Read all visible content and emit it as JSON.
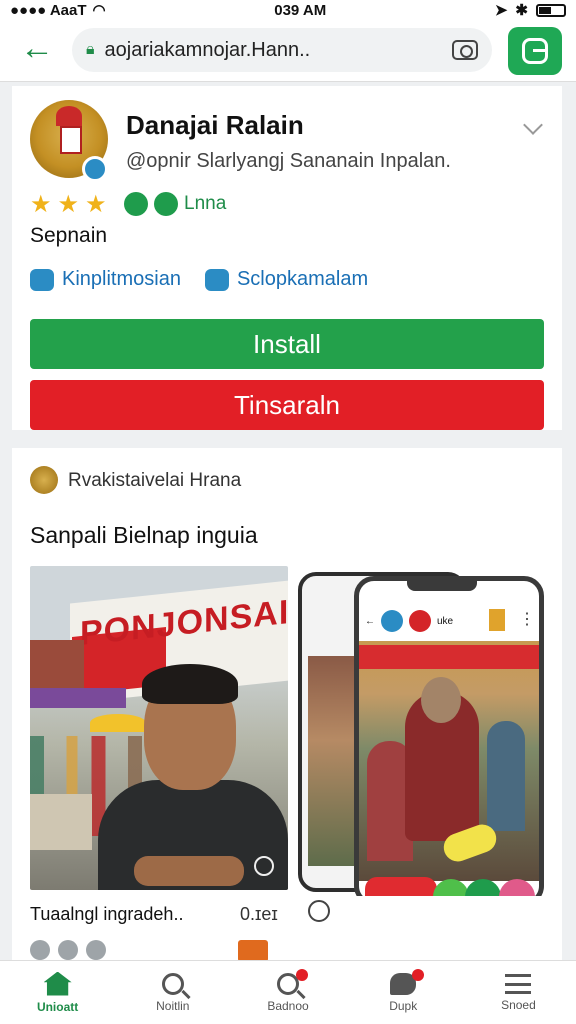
{
  "status_bar": {
    "carrier": "●●●● AaaT",
    "time": "039 AM"
  },
  "browser": {
    "url": "aojariakamnojar.Hann.."
  },
  "app": {
    "title": "Danajai Ralain",
    "subtitle": "@opnir Slarlyangj Sananain Inpalan.",
    "stars": 3,
    "badge_text": "Lnna",
    "category": "Sepnain",
    "links": [
      {
        "label": "Kinplitmosian",
        "icon": "person-icon"
      },
      {
        "label": "Sclopkamalam",
        "icon": "share-icon"
      }
    ],
    "install_label": "Install",
    "secondary_label": "Tinsaraln"
  },
  "media": {
    "source_name": "Rvakistaivelai Hrana",
    "section_title": "Sanpali Bielnap inguia",
    "photo_banner_text": "PONJONSAI",
    "phone_header_text": "uke",
    "caption": "Tuaalngl ingradeh..",
    "caption_meta": "0.ɪeɪ"
  },
  "bottom_nav": [
    {
      "label": "Unioatt",
      "icon": "home-icon",
      "active": true,
      "badge": false
    },
    {
      "label": "Noitlin",
      "icon": "search-icon",
      "active": false,
      "badge": false
    },
    {
      "label": "Badnoo",
      "icon": "search-icon",
      "active": false,
      "badge": true
    },
    {
      "label": "Dupk",
      "icon": "chat-icon",
      "active": false,
      "badge": true
    },
    {
      "label": "Snoed",
      "icon": "menu-icon",
      "active": false,
      "badge": false
    }
  ],
  "colors": {
    "brand_green": "#1f8c49",
    "install_green": "#23a14b",
    "alert_red": "#e21f26",
    "link_blue": "#1a6fb5",
    "star_gold": "#f0b21a"
  }
}
